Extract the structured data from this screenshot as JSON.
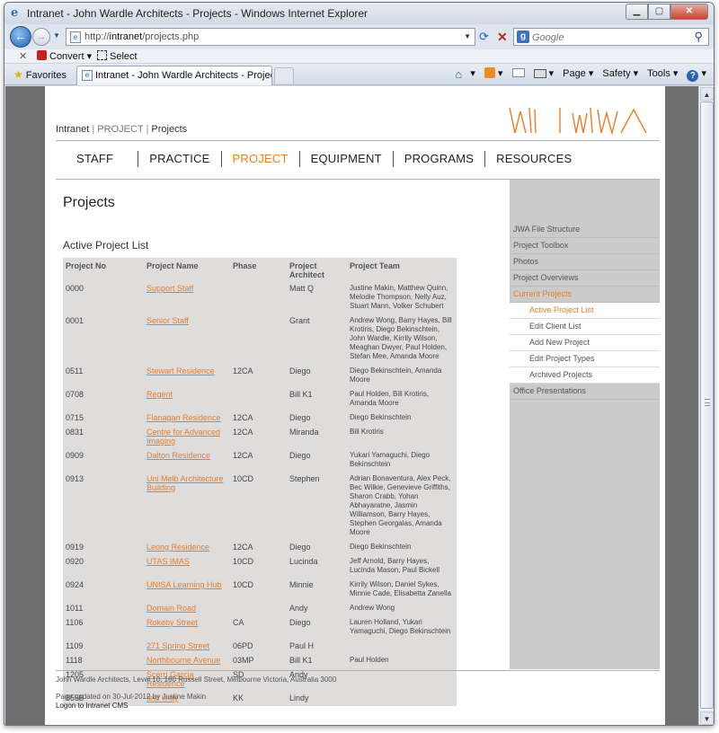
{
  "window": {
    "title": "Intranet - John Wardle Architects - Projects - Windows Internet Explorer",
    "controls": {
      "minimize": "▁",
      "maximize": "▢",
      "close": "✕"
    }
  },
  "addressbar": {
    "url_prefix": "http://",
    "url_host": "intranet",
    "url_path": "/projects.php",
    "search_placeholder": "Google"
  },
  "linksbar": {
    "close": "✕",
    "convert_label": "Convert",
    "select_label": "Select"
  },
  "favbar": {
    "favorites_label": "Favorites",
    "tab_title": "Intranet - John Wardle Architects - Projects",
    "commands": {
      "page": "Page",
      "safety": "Safety",
      "tools": "Tools"
    }
  },
  "site": {
    "breadcrumb": {
      "home": "Intranet",
      "section": "PROJECT",
      "current": "Projects"
    },
    "nav": [
      "STAFF",
      "PRACTICE",
      "PROJECT",
      "EQUIPMENT",
      "PROGRAMS",
      "RESOURCES"
    ],
    "nav_active": "PROJECT",
    "page_title": "Projects",
    "section_title": "Active Project List",
    "accent_color": "#ea7d24"
  },
  "table": {
    "headers": [
      "Project No",
      "Project Name",
      "Phase",
      "Project Architect",
      "Project Team"
    ],
    "rows": [
      {
        "no": "0000",
        "name": "Support Staff",
        "phase": "",
        "architect": "Matt Q",
        "team": "Justine Makin, Matthew Quinn, Melodie Thompson, Nelly Auz, Stuart Mann, Volker Schubert"
      },
      {
        "no": "0001",
        "name": "Senior Staff",
        "phase": "",
        "architect": "Grant",
        "team": "Andrew Wong, Barry Hayes, Bill Krotiris, Diego Bekinschtein, John Wardle, Kirrily Wilson, Meaghan Dwyer, Paul Holden, Stefan Mee, Amanda Moore"
      },
      {
        "no": "0511",
        "name": "Stewart Residence",
        "phase": "12CA",
        "architect": "Diego",
        "team": "Diego Bekinschtein, Amanda Moore"
      },
      {
        "no": "0708",
        "name": "Regent",
        "phase": "",
        "architect": "Bill K1",
        "team": "Paul Holden, Bill Krotiris, Amanda Moore"
      },
      {
        "no": "0715",
        "name": "Flanagan Residence",
        "phase": "12CA",
        "architect": "Diego",
        "team": "Diego Bekinschtein"
      },
      {
        "no": "0831",
        "name": "Centre for Advanced Imaging",
        "phase": "12CA",
        "architect": "Miranda",
        "team": "Bill Krotiris"
      },
      {
        "no": "0909",
        "name": "Dalton Residence",
        "phase": "12CA",
        "architect": "Diego",
        "team": "Yukari Yamaguchi, Diego Bekinschtein"
      },
      {
        "no": "0913",
        "name": "Uni Melb Architecture Building",
        "phase": "10CD",
        "architect": "Stephen",
        "team": "Adrian Bonaventura, Alex Peck, Bec Wilkie, Genevieve Griffiths, Sharon Crabb, Yohan Abhayaratne, Jasmin Williamson, Barry Hayes, Stephen Georgalas, Amanda Moore"
      },
      {
        "no": "0919",
        "name": "Leong Residence",
        "phase": "12CA",
        "architect": "Diego",
        "team": "Diego Bekinschtein"
      },
      {
        "no": "0920",
        "name": "UTAS IMAS",
        "phase": "10CD",
        "architect": "Lucinda",
        "team": "Jeff Arnold, Barry Hayes, Lucinda Mason, Paul Bickell"
      },
      {
        "no": "0924",
        "name": "UNISA Learning Hub",
        "phase": "10CD",
        "architect": "Minnie",
        "team": "Kirrily Wilson, Daniel Sykes, Minnie Cade, Elisabetta Zanella"
      },
      {
        "no": "1011",
        "name": "Domain Road",
        "phase": "",
        "architect": "Andy",
        "team": "Andrew Wong"
      },
      {
        "no": "1106",
        "name": "Rokeby Street",
        "phase": "CA",
        "architect": "Diego",
        "team": "Lauren Holland, Yukari Yamaguchi, Diego Bekinschtein"
      },
      {
        "no": "1109",
        "name": "271 Spring Street",
        "phase": "06PD",
        "architect": "Paul H",
        "team": ""
      },
      {
        "no": "1118",
        "name": "Northbourne Avenue",
        "phase": "03MP",
        "architect": "Bill K1",
        "team": "Paul Holden"
      },
      {
        "no": "1205",
        "name": "Scerri Garcia Residence",
        "phase": "SD",
        "architect": "Andy",
        "team": ""
      },
      {
        "no": "5555",
        "name": "test lindy",
        "phase": "KK",
        "architect": "Lindy",
        "team": ""
      }
    ]
  },
  "sidebar": {
    "items": [
      {
        "label": "JWA File Structure",
        "type": "top"
      },
      {
        "label": "Project Toolbox",
        "type": "top"
      },
      {
        "label": "Photos",
        "type": "top"
      },
      {
        "label": "Project Overviews",
        "type": "top"
      },
      {
        "label": "Current Projects",
        "type": "current"
      },
      {
        "label": "Active Project List",
        "type": "sub-active"
      },
      {
        "label": "Edit Client List",
        "type": "sub"
      },
      {
        "label": "Add New Project",
        "type": "sub"
      },
      {
        "label": "Edit Project Types",
        "type": "sub"
      },
      {
        "label": "Archived Projects",
        "type": "sub"
      },
      {
        "label": "Office Presentations",
        "type": "top"
      }
    ]
  },
  "footer": {
    "address": "John Wardle Architects, Level 10, 180 Russell Street, Melbourne Victoria, Australia 3000",
    "updated": "Page updated on 30-Jul-2012 by Justine Makin",
    "cms_link": "Logon to Intranet CMS"
  },
  "icons": [
    "ie-icon",
    "back-arrow-icon",
    "forward-arrow-icon",
    "page-icon",
    "refresh-icon",
    "stop-icon",
    "google-icon",
    "search-icon",
    "star-icon",
    "home-icon",
    "feed-icon",
    "mail-icon",
    "print-icon",
    "help-icon"
  ]
}
